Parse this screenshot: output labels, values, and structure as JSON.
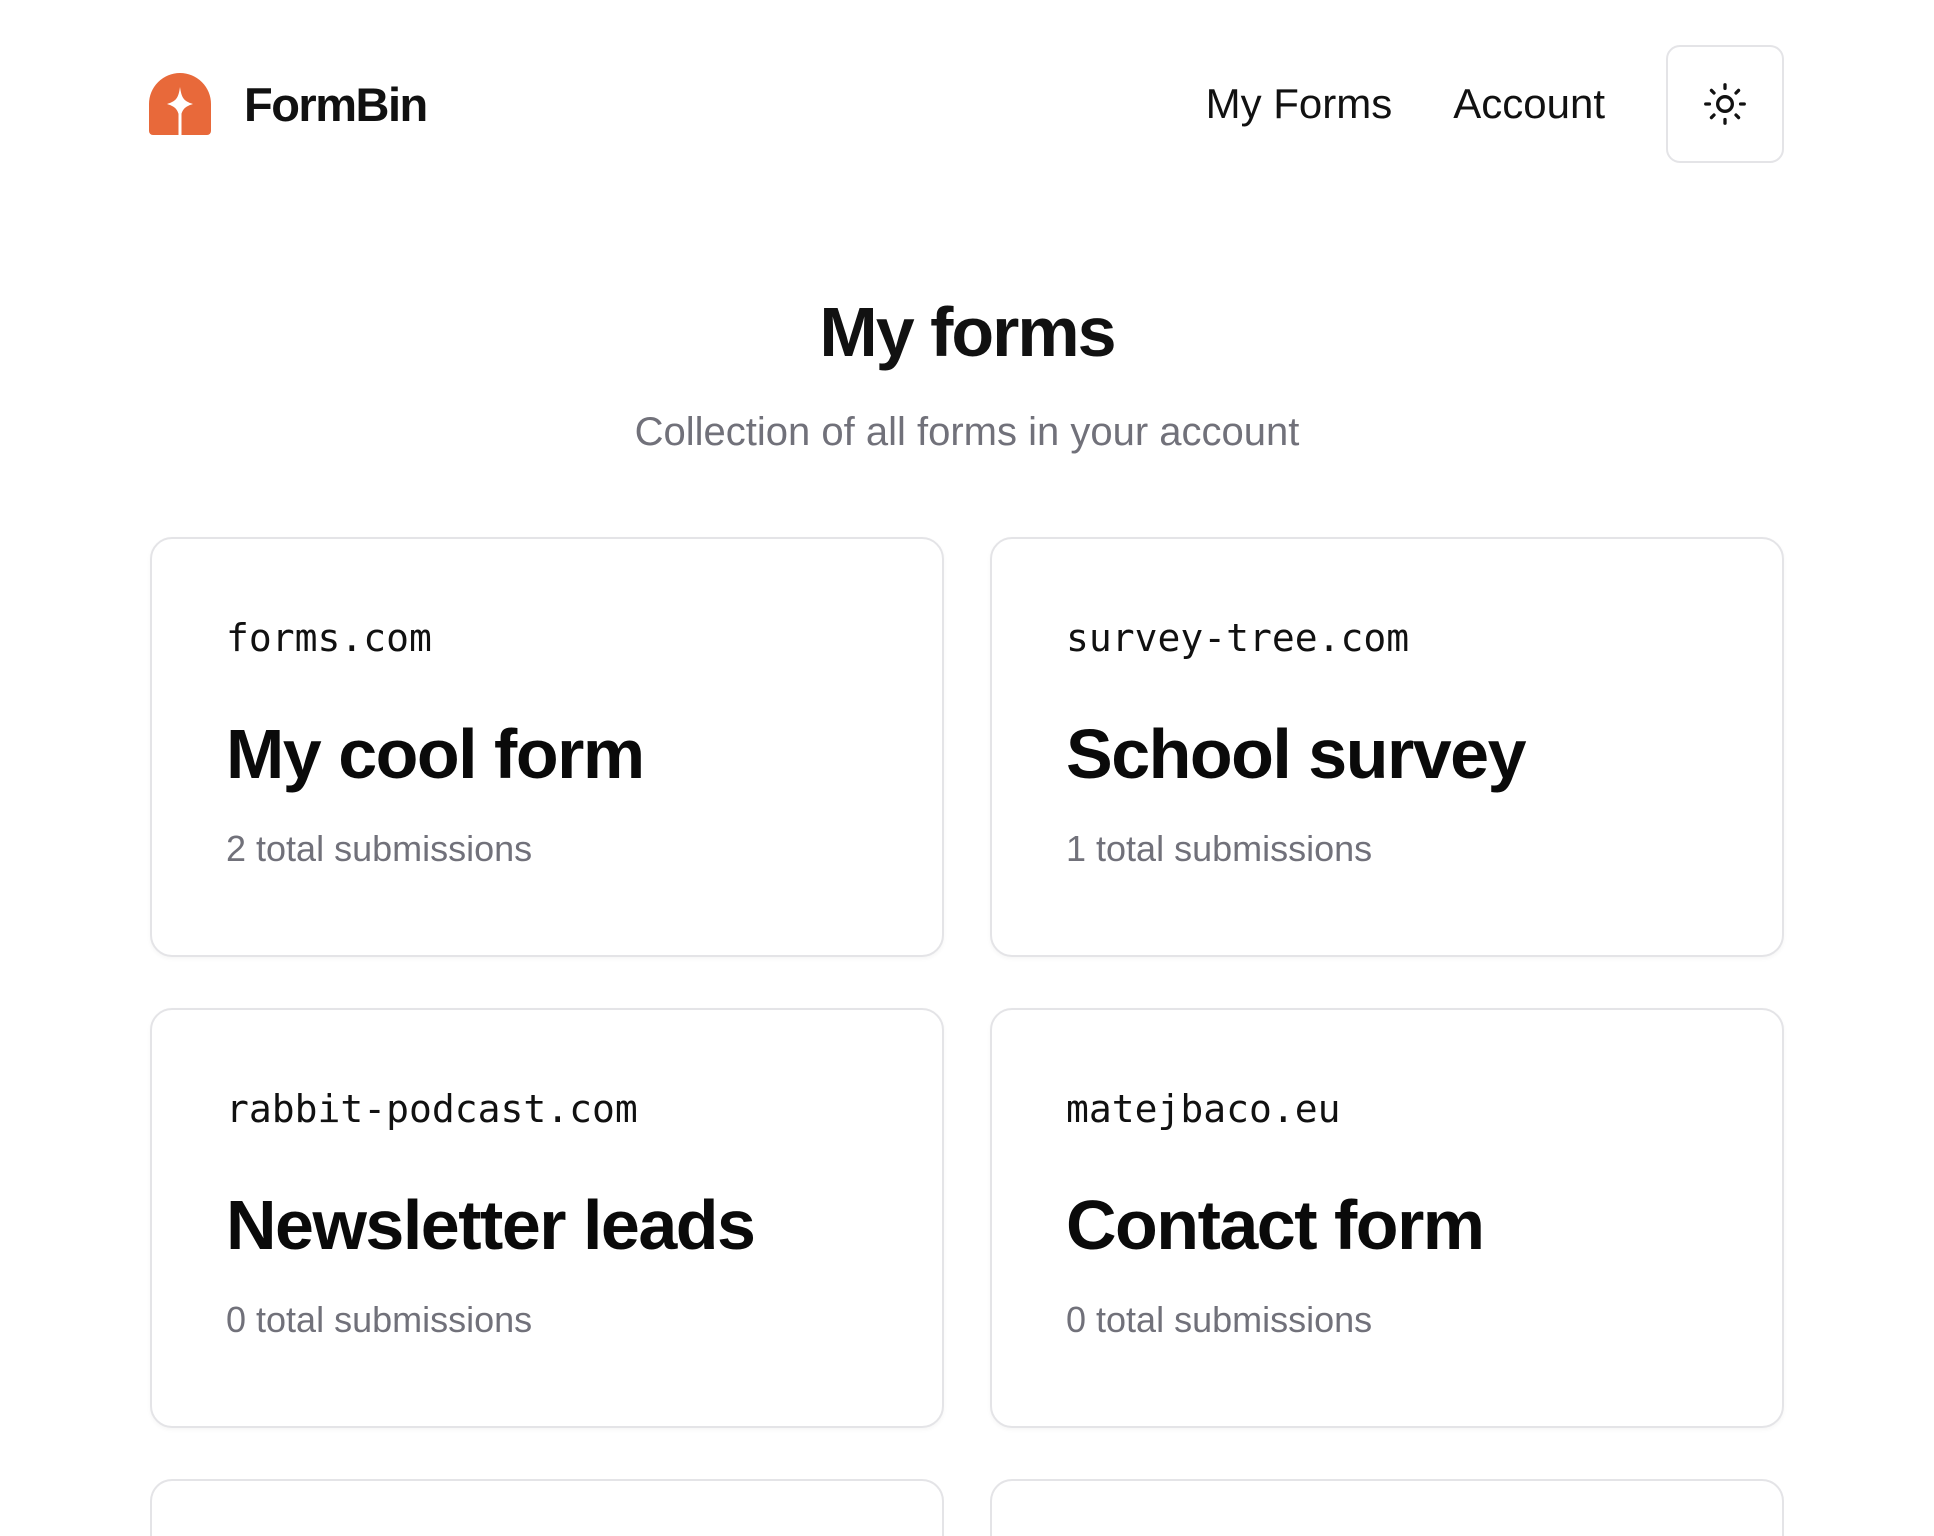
{
  "brand": {
    "name": "FormBin",
    "logo_icon": "formbin-logo-icon",
    "logo_color": "#E8693A"
  },
  "nav": {
    "items": [
      {
        "label": "My Forms"
      },
      {
        "label": "Account"
      }
    ],
    "theme_toggle_icon": "sun-icon"
  },
  "page": {
    "title": "My forms",
    "subtitle": "Collection of all forms in your account"
  },
  "forms": [
    {
      "domain": "forms.com",
      "name": "My cool form",
      "submissions": "2 total submissions"
    },
    {
      "domain": "survey-tree.com",
      "name": "School survey",
      "submissions": "1 total submissions"
    },
    {
      "domain": "rabbit-podcast.com",
      "name": "Newsletter leads",
      "submissions": "0 total submissions"
    },
    {
      "domain": "matejbaco.eu",
      "name": "Contact form",
      "submissions": "0 total submissions"
    }
  ],
  "colors": {
    "accent": "#E8693A",
    "text": "#111111",
    "muted": "#71717A",
    "border": "#E4E4E7"
  }
}
